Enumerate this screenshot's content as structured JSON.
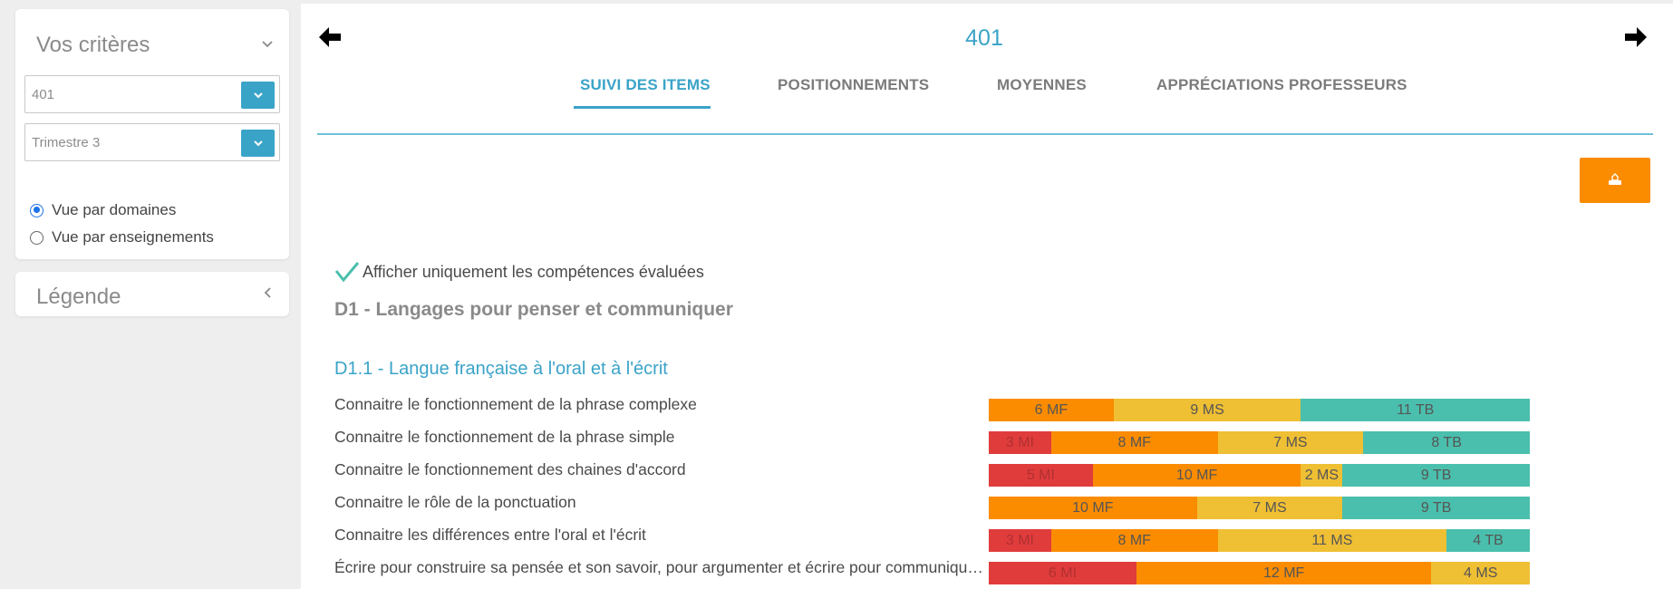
{
  "sidebar": {
    "criteria_title": "Vos critères",
    "class_select": {
      "value": "401"
    },
    "period_select": {
      "value": "Trimestre 3"
    },
    "view_options": [
      {
        "label": "Vue par domaines",
        "selected": true
      },
      {
        "label": "Vue par enseignements",
        "selected": false
      }
    ],
    "legend_title": "Légende"
  },
  "header": {
    "class_title": "401",
    "tabs": [
      {
        "label": "SUIVI DES ITEMS",
        "active": true
      },
      {
        "label": "POSITIONNEMENTS",
        "active": false
      },
      {
        "label": "MOYENNES",
        "active": false
      },
      {
        "label": "APPRÉCIATIONS PROFESSEURS",
        "active": false
      }
    ]
  },
  "content": {
    "filter_label": "Afficher uniquement les compétences évaluées",
    "domain_title": "D1 - Langages pour penser et communiquer",
    "subdomain_title": "D1.1 - Langue française à l'oral et à l'écrit",
    "items": [
      {
        "label": "Connaitre le fonctionnement de la phrase complexe",
        "segments": [
          {
            "level": "MF",
            "count": 6,
            "text": "6 MF"
          },
          {
            "level": "MS",
            "count": 9,
            "text": "9 MS"
          },
          {
            "level": "TB",
            "count": 11,
            "text": "11 TB"
          }
        ]
      },
      {
        "label": "Connaitre le fonctionnement de la phrase simple",
        "segments": [
          {
            "level": "MI",
            "count": 3,
            "text": "3 MI"
          },
          {
            "level": "MF",
            "count": 8,
            "text": "8 MF"
          },
          {
            "level": "MS",
            "count": 7,
            "text": "7 MS"
          },
          {
            "level": "TB",
            "count": 8,
            "text": "8 TB"
          }
        ]
      },
      {
        "label": "Connaitre le fonctionnement des chaines d'accord",
        "segments": [
          {
            "level": "MI",
            "count": 5,
            "text": "5 MI"
          },
          {
            "level": "MF",
            "count": 10,
            "text": "10 MF"
          },
          {
            "level": "MS",
            "count": 2,
            "text": "2 MS"
          },
          {
            "level": "TB",
            "count": 9,
            "text": "9 TB"
          }
        ]
      },
      {
        "label": "Connaitre le rôle de la ponctuation",
        "segments": [
          {
            "level": "MF",
            "count": 10,
            "text": "10 MF"
          },
          {
            "level": "MS",
            "count": 7,
            "text": "7 MS"
          },
          {
            "level": "TB",
            "count": 9,
            "text": "9 TB"
          }
        ]
      },
      {
        "label": "Connaitre les différences entre l'oral et l'écrit",
        "segments": [
          {
            "level": "MI",
            "count": 3,
            "text": "3 MI"
          },
          {
            "level": "MF",
            "count": 8,
            "text": "8 MF"
          },
          {
            "level": "MS",
            "count": 11,
            "text": "11 MS"
          },
          {
            "level": "TB",
            "count": 4,
            "text": "4 TB"
          }
        ]
      },
      {
        "label": "Écrire pour construire sa pensée et son savoir, pour argumenter et écrire pour communique…",
        "segments": [
          {
            "level": "MI",
            "count": 6,
            "text": "6 MI"
          },
          {
            "level": "MF",
            "count": 12,
            "text": "12 MF"
          },
          {
            "level": "MS",
            "count": 4,
            "text": "4 MS"
          }
        ]
      }
    ]
  },
  "colors": {
    "accent": "#3aa3c8",
    "MI": "#e03c3c",
    "MF": "#fb8c00",
    "MS": "#efbf34",
    "TB": "#4bbfad"
  },
  "icons": {
    "prev": "arrow-left-icon",
    "next": "arrow-right-icon",
    "print": "print-icon",
    "dropdown": "chevron-down-icon",
    "check": "check-icon"
  }
}
